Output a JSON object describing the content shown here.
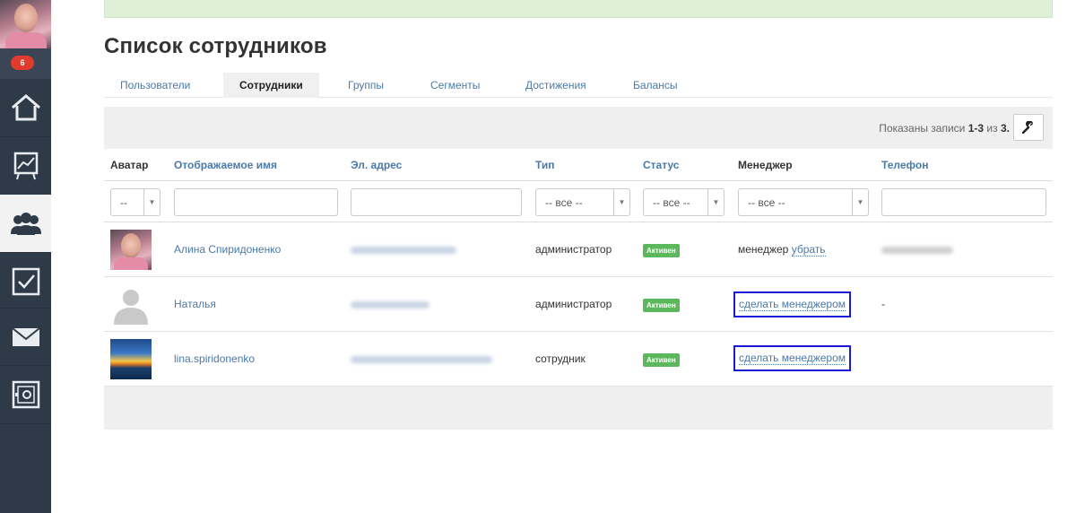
{
  "sidebar": {
    "badge_count": "6",
    "items": [
      {
        "icon": "home-icon"
      },
      {
        "icon": "chart-icon"
      },
      {
        "icon": "users-icon",
        "active": true
      },
      {
        "icon": "checkbox-icon"
      },
      {
        "icon": "mail-icon"
      },
      {
        "icon": "safe-icon"
      }
    ]
  },
  "page": {
    "title": "Список сотрудников"
  },
  "tabs": [
    {
      "label": "Пользователи"
    },
    {
      "label": "Сотрудники",
      "active": true
    },
    {
      "label": "Группы"
    },
    {
      "label": "Сегменты"
    },
    {
      "label": "Достижения"
    },
    {
      "label": "Балансы"
    }
  ],
  "toolbar": {
    "records_prefix": "Показаны записи",
    "records_range": "1-3",
    "records_of": "из",
    "records_total": "3."
  },
  "table": {
    "headers": {
      "avatar": "Аватар",
      "name": "Отображаемое имя",
      "email": "Эл. адрес",
      "type": "Тип",
      "status": "Статус",
      "manager": "Менеджер",
      "phone": "Телефон"
    },
    "filters": {
      "avatar": "--",
      "type": "-- все --",
      "status": "-- все --",
      "manager": "-- все --"
    },
    "rows": [
      {
        "name": "Алина Спиридоненко",
        "type": "администратор",
        "status": "Активен",
        "manager_text": "менеджер",
        "manager_link": "убрать",
        "phone": ""
      },
      {
        "name": "Наталья",
        "type": "администратор",
        "status": "Активен",
        "manager_link": "сделать менеджером",
        "phone": "-"
      },
      {
        "name": "lina.spiridonenko",
        "type": "сотрудник",
        "status": "Активен",
        "manager_link": "сделать менеджером",
        "phone": ""
      }
    ]
  },
  "colors": {
    "sidebar_bg": "#2f3a49",
    "link": "#4a7aa8",
    "status_active": "#5cb85c",
    "highlight_box": "#1a1ad6"
  }
}
